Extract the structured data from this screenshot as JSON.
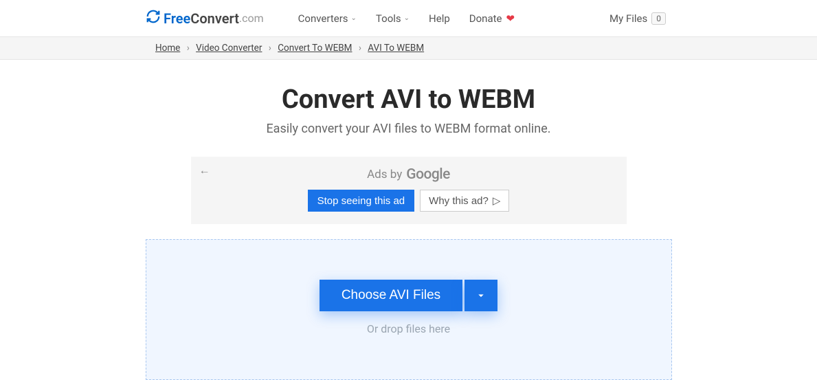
{
  "header": {
    "logo": {
      "free": "Free",
      "convert": "Convert",
      "com": ".com"
    },
    "nav": {
      "converters": "Converters",
      "tools": "Tools",
      "help": "Help",
      "donate": "Donate"
    },
    "my_files": {
      "label": "My Files",
      "count": "0"
    }
  },
  "breadcrumb": {
    "items": [
      "Home",
      "Video Converter",
      "Convert To WEBM",
      "AVI To WEBM"
    ]
  },
  "main": {
    "title": "Convert AVI to WEBM",
    "subtitle": "Easily convert your AVI files to WEBM format online."
  },
  "ad": {
    "ads_by": "Ads by",
    "google": "Google",
    "stop": "Stop seeing this ad",
    "why": "Why this ad?"
  },
  "dropzone": {
    "choose": "Choose AVI Files",
    "drop": "Or drop files here"
  }
}
